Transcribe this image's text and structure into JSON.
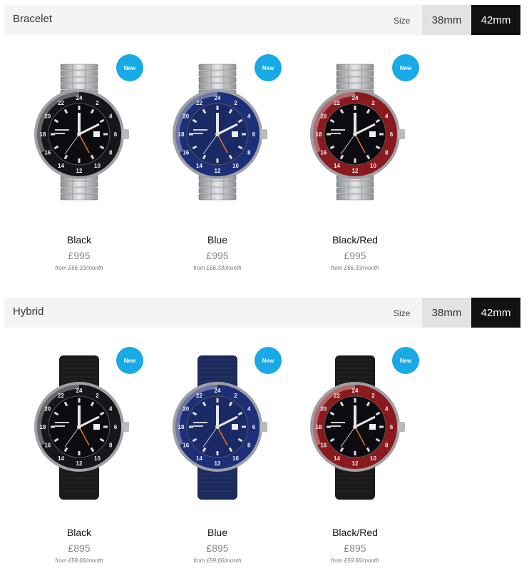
{
  "sections": [
    {
      "title": "Bracelet",
      "size_label": "Size",
      "sizes": [
        "38mm",
        "42mm"
      ],
      "selected_size": "42mm",
      "strap": "bracelet",
      "products": [
        {
          "name": "Black",
          "price": "£995",
          "finance": "from £66.33/month",
          "badge": "New",
          "bezel_color": "#15151c",
          "dial_color": "#0c0c10"
        },
        {
          "name": "Blue",
          "price": "£995",
          "finance": "from £66.33/month",
          "badge": "New",
          "bezel_color": "#1c2f78",
          "dial_color": "#1a2a66"
        },
        {
          "name": "Black/Red",
          "price": "£995",
          "finance": "from £66.33/month",
          "badge": "New",
          "bezel_color": "#8a1a1e",
          "dial_color": "#0c0c10"
        }
      ]
    },
    {
      "title": "Hybrid",
      "size_label": "Size",
      "sizes": [
        "38mm",
        "42mm"
      ],
      "selected_size": "42mm",
      "strap": "rubber",
      "products": [
        {
          "name": "Black",
          "price": "£895",
          "finance": "from £59.66/month",
          "badge": "New",
          "bezel_color": "#15151c",
          "dial_color": "#0c0c10",
          "strap_color": "#1a1a1a"
        },
        {
          "name": "Blue",
          "price": "£895",
          "finance": "from £59.66/month",
          "badge": "New",
          "bezel_color": "#1c2f78",
          "dial_color": "#1a2a66",
          "strap_color": "#1c2a5e"
        },
        {
          "name": "Black/Red",
          "price": "£895",
          "finance": "from £59.66/month",
          "badge": "New",
          "bezel_color": "#8a1a1e",
          "dial_color": "#0c0c10",
          "strap_color": "#1a1a1a"
        }
      ]
    }
  ]
}
